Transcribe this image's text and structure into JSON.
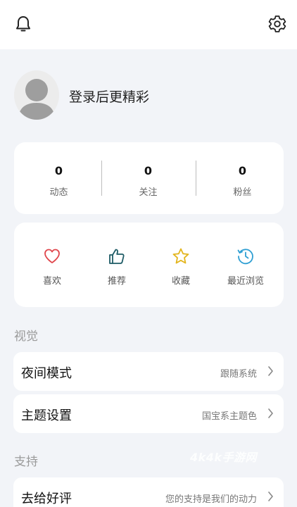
{
  "header": {
    "notification_icon": "bell-icon",
    "settings_icon": "gear-icon"
  },
  "profile": {
    "login_prompt": "登录后更精彩",
    "avatar_icon": "default-avatar-icon"
  },
  "stats": [
    {
      "value": "0",
      "label": "动态"
    },
    {
      "value": "0",
      "label": "关注"
    },
    {
      "value": "0",
      "label": "粉丝"
    }
  ],
  "quick_actions": [
    {
      "label": "喜欢",
      "icon": "heart-icon",
      "color": "#e0454b"
    },
    {
      "label": "推荐",
      "icon": "thumbs-up-icon",
      "color": "#1f5c66"
    },
    {
      "label": "收藏",
      "icon": "star-icon",
      "color": "#e3b51d"
    },
    {
      "label": "最近浏览",
      "icon": "history-clock-icon",
      "color": "#2f9fd3"
    }
  ],
  "sections": {
    "visual": {
      "title": "视觉",
      "rows": [
        {
          "title": "夜间模式",
          "value": "跟随系统"
        },
        {
          "title": "主题设置",
          "value": "国宝系主题色"
        }
      ]
    },
    "support": {
      "title": "支持",
      "rows": [
        {
          "title": "去给好评",
          "value": "您的支持是我们的动力"
        }
      ]
    }
  },
  "watermark": "4k4k手游网"
}
